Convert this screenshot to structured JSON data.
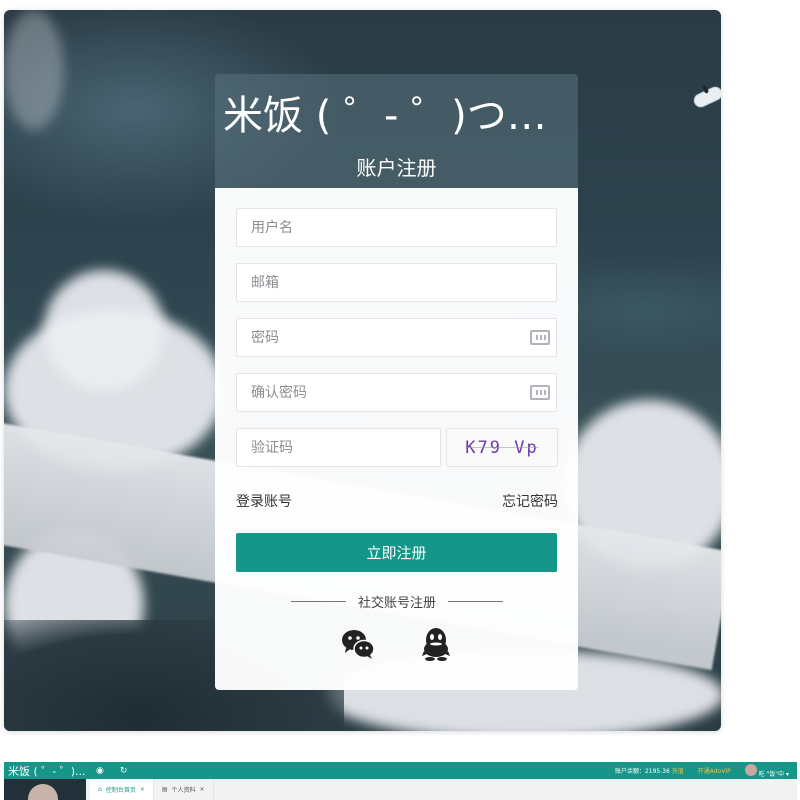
{
  "login_page": {
    "site_title": "米饭 ( ゜- ゜)つロ...",
    "subtitle": "账户注册",
    "fields": {
      "username_placeholder": "用户名",
      "email_placeholder": "邮箱",
      "password_placeholder": "密码",
      "confirm_password_placeholder": "确认密码",
      "captcha_placeholder": "验证码"
    },
    "captcha_text": "K79 Vp",
    "login_link": "登录账号",
    "forgot_link": "忘记密码",
    "register_button": "立即注册",
    "social_label": "社交账号注册",
    "social_icons": [
      "wechat-icon",
      "qq-icon"
    ]
  },
  "dashboard_preview": {
    "title": "米饭 ( ゜- ゜)...",
    "header_right": {
      "balance_label": "账户余额：",
      "balance_value": "2195.36",
      "recharge": "充值",
      "vip": "开通AdoVIP",
      "username": "吃 \"饭\"中"
    },
    "tabs": [
      "控制台首页",
      "个人资料"
    ]
  },
  "colors": {
    "accent": "#159688",
    "gold": "#f5c24a"
  }
}
